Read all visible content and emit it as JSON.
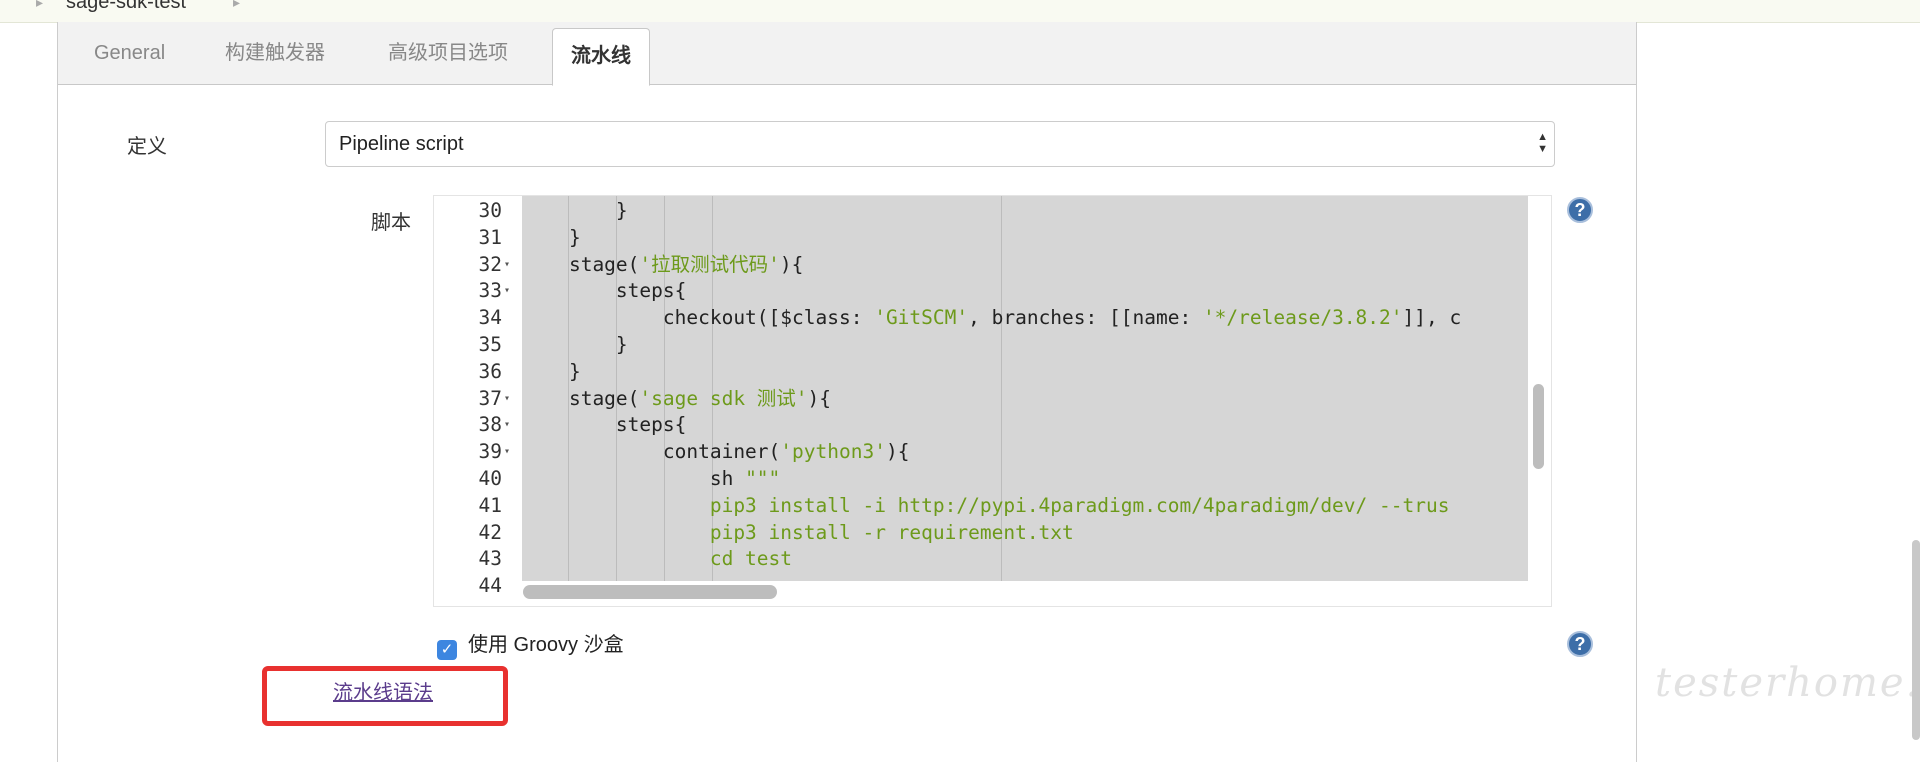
{
  "breadcrumb": {
    "project": "sage-sdk-test"
  },
  "tabs": [
    {
      "label": "General",
      "active": false
    },
    {
      "label": "构建触发器",
      "active": false
    },
    {
      "label": "高级项目选项",
      "active": false
    },
    {
      "label": "流水线",
      "active": true
    }
  ],
  "definition": {
    "label": "定义",
    "selected": "Pipeline script"
  },
  "script": {
    "label": "脚本",
    "lines": [
      {
        "n": "30",
        "fold": false,
        "code": "        }"
      },
      {
        "n": "31",
        "fold": false,
        "code": "    }"
      },
      {
        "n": "32",
        "fold": true,
        "pre": "    stage(",
        "str": "'拉取测试代码'",
        "post": "){"
      },
      {
        "n": "33",
        "fold": true,
        "code": "        steps{"
      },
      {
        "n": "34",
        "fold": false,
        "pre": "            checkout([$class: ",
        "str": "'GitSCM'",
        "post": ", branches: [[name: ",
        "str2": "'*/release/3.8.2'",
        "post2": "]], c"
      },
      {
        "n": "35",
        "fold": false,
        "code": "        }"
      },
      {
        "n": "36",
        "fold": false,
        "code": "    }"
      },
      {
        "n": "37",
        "fold": true,
        "pre": "    stage(",
        "str": "'sage sdk 测试'",
        "post": "){"
      },
      {
        "n": "38",
        "fold": true,
        "code": "        steps{"
      },
      {
        "n": "39",
        "fold": true,
        "pre": "            container(",
        "str": "'python3'",
        "post": "){"
      },
      {
        "n": "40",
        "fold": false,
        "pre": "                sh ",
        "str": "\"\"\"",
        "post": ""
      },
      {
        "n": "41",
        "fold": false,
        "strline": "                pip3 install -i http://pypi.4paradigm.com/4paradigm/dev/ --trus"
      },
      {
        "n": "42",
        "fold": false,
        "strline": "                pip3 install -r requirement.txt"
      },
      {
        "n": "43",
        "fold": false,
        "strline": "                cd test"
      },
      {
        "n": "44",
        "fold": false,
        "code": ""
      }
    ]
  },
  "sandbox": {
    "label": "使用 Groovy 沙盒",
    "checked": true
  },
  "syntax_link": "流水线语法",
  "watermark": "testerhome.com",
  "icons": {
    "help": "?",
    "check": "✓",
    "select_arrows": "▲▼",
    "fold": "▾",
    "crumb": "▸"
  }
}
